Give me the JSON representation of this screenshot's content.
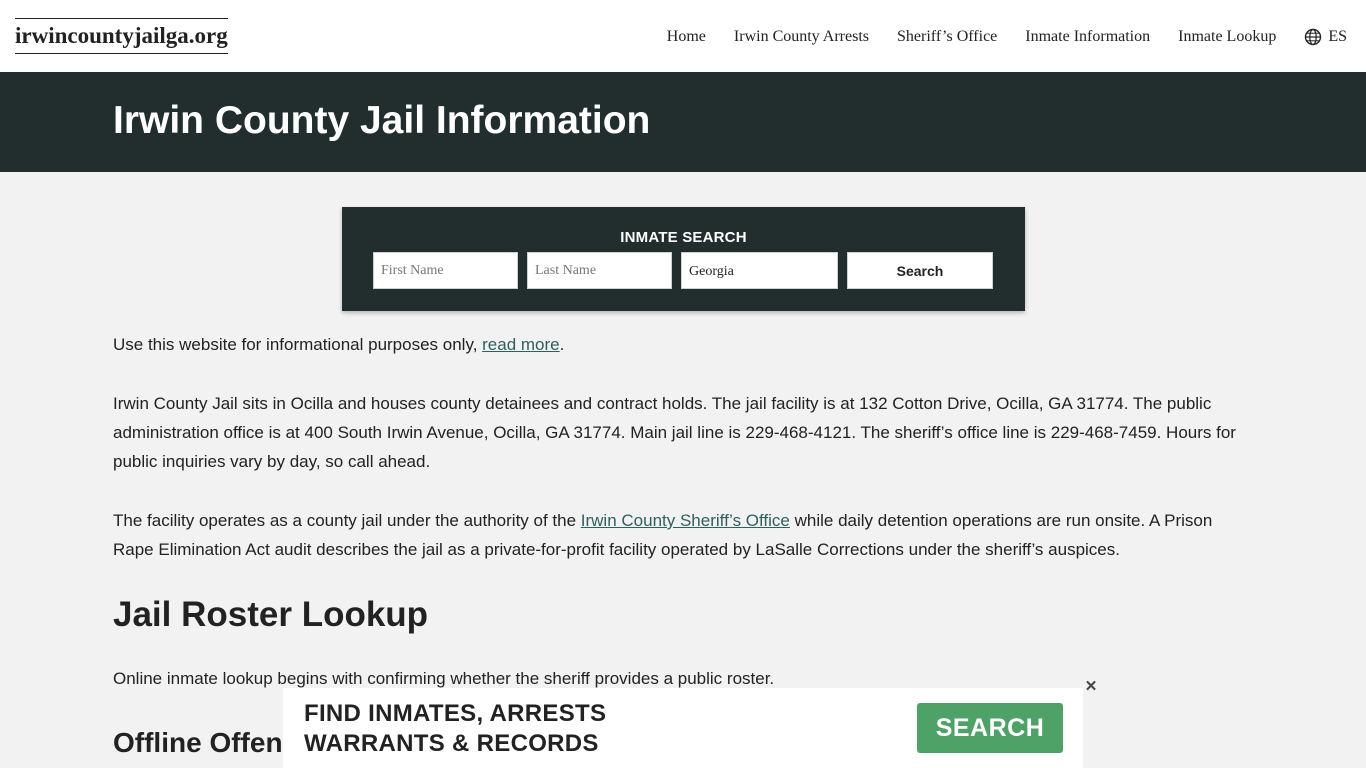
{
  "header": {
    "logo": "irwincountyjailga.org",
    "nav": [
      {
        "label": "Home"
      },
      {
        "label": "Irwin County Arrests"
      },
      {
        "label": "Sheriff’s Office"
      },
      {
        "label": "Inmate Information"
      },
      {
        "label": "Inmate Lookup"
      }
    ],
    "language": {
      "label": "ES",
      "icon": "globe-icon"
    }
  },
  "hero": {
    "title": "Irwin County Jail Information"
  },
  "search": {
    "title": "INMATE SEARCH",
    "first_name_placeholder": "First Name",
    "last_name_placeholder": "Last Name",
    "state_value": "Georgia",
    "button_label": "Search"
  },
  "content": {
    "disclaimer_text": "Use this website for informational purposes only, ",
    "disclaimer_link": "read more",
    "disclaimer_end": ".",
    "paragraph_1": "Irwin County Jail sits in Ocilla and houses county detainees and contract holds. The jail facility is at 132 Cotton Drive, Ocilla, GA 31774. The public administration office is at 400 South Irwin Avenue, Ocilla, GA 31774. Main jail line is 229-468-4121. The sheriff’s office line is 229-468-7459. Hours for public inquiries vary by day, so call ahead.",
    "paragraph_2_start": "The facility operates as a county jail under the authority of the ",
    "paragraph_2_link": "Irwin County Sheriff’s Office",
    "paragraph_2_end": " while daily detention operations are run onsite. A Prison Rape Elimination Act audit describes the jail as a private-for-profit facility operated by LaSalle Corrections under the sheriff’s auspices.",
    "heading_1": "Jail Roster Lookup",
    "paragraph_3": "Online inmate lookup begins with confirming whether the sheriff provides a public roster.",
    "heading_2": "Offline Offen"
  },
  "banner": {
    "line_1": "FIND INMATES, ARRESTS",
    "line_2": "WARRANTS & RECORDS",
    "button_label": "SEARCH",
    "close_label": "✕",
    "button_color": "#4fa267"
  },
  "colors": {
    "dark": "#222d2d",
    "background": "#f2f2f2",
    "link": "#2f5f5f"
  }
}
